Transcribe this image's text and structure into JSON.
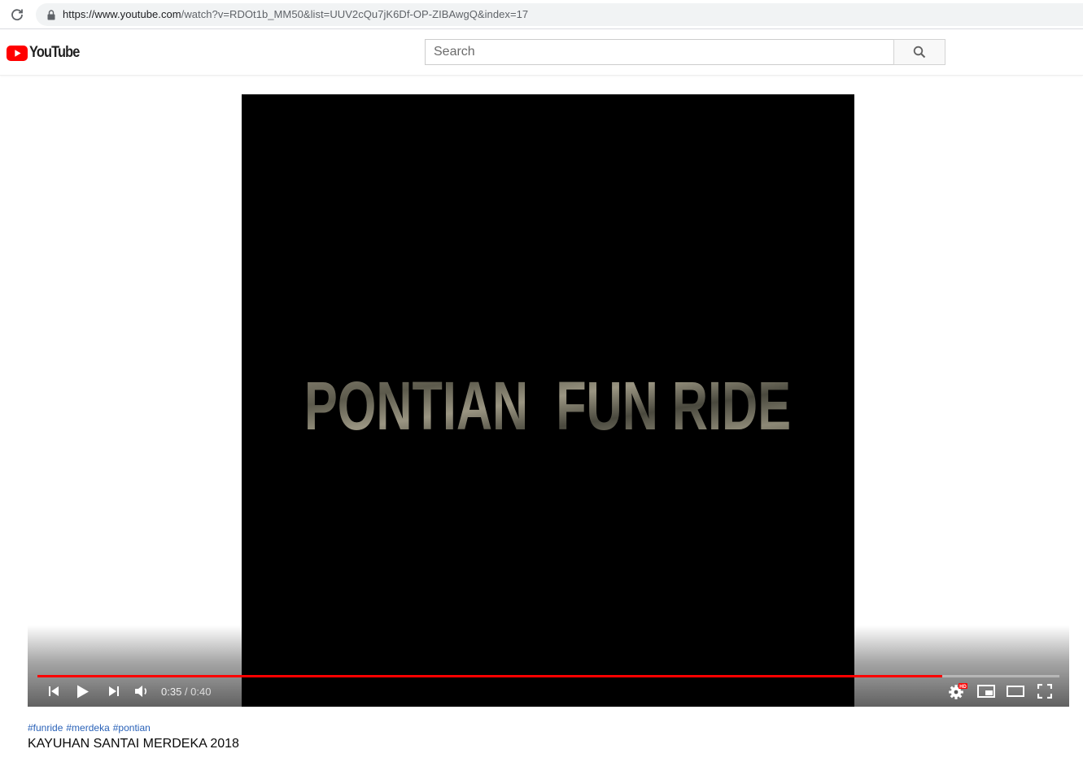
{
  "browser": {
    "url_host": "https://www.youtube.com",
    "url_path": "/watch?v=RDOt1b_MM50&list=UUV2cQu7jK6Df-OP-ZIBAwgQ&index=17"
  },
  "masthead": {
    "logo_text": "YouTube",
    "search_placeholder": "Search"
  },
  "player": {
    "overlay_title": "PONTIAN  FUN RIDE",
    "current_time": "0:35",
    "time_separator": " / ",
    "duration": "0:40",
    "progress_fraction": 0.885,
    "hd_badge": "HD"
  },
  "video": {
    "hashtags": [
      "#funride",
      "#merdeka",
      "#pontian"
    ],
    "title": "KAYUHAN SANTAI MERDEKA 2018"
  },
  "colors": {
    "accent_red": "#ff0000",
    "hashtag_blue": "#2a62b8"
  }
}
